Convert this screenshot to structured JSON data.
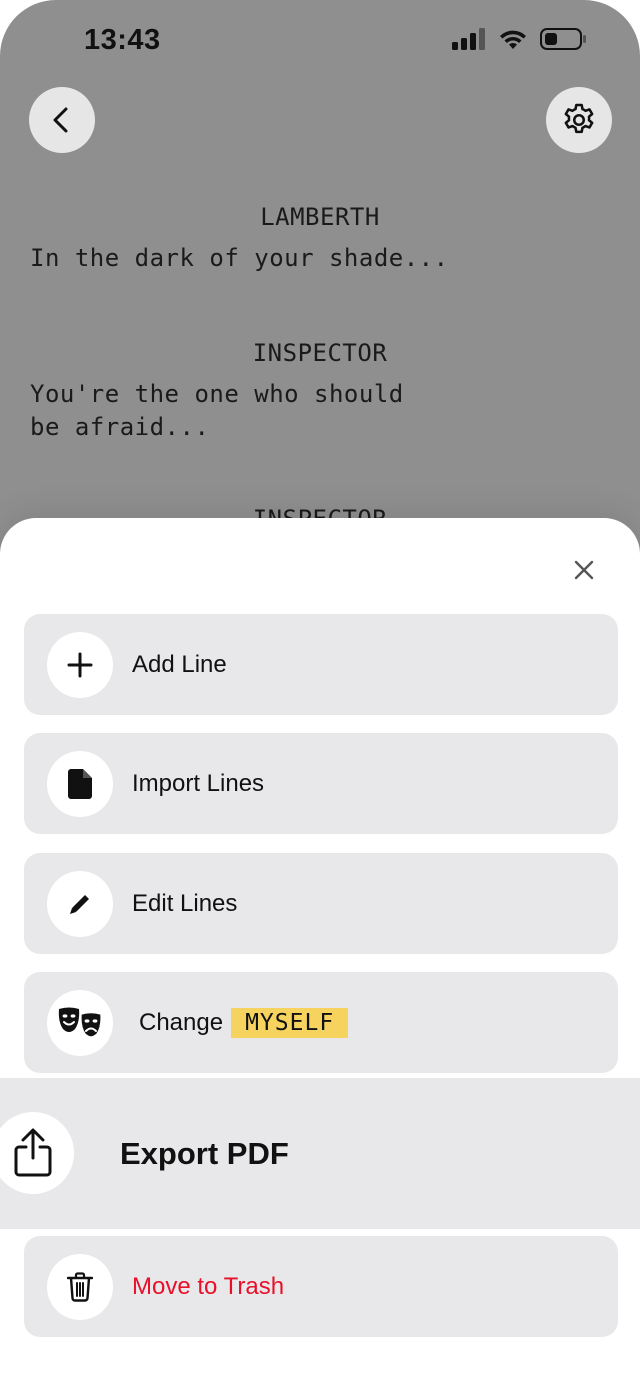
{
  "status_bar": {
    "time": "13:43"
  },
  "script": {
    "blocks": [
      {
        "character": "LAMBERTH",
        "dialogue": "In the dark of your shade..."
      },
      {
        "character": "INSPECTOR",
        "dialogue": "You're the one who should\nbe afraid..."
      },
      {
        "character": "INSPECTOR"
      }
    ]
  },
  "menu": {
    "add_line": "Add Line",
    "import_lines": "Import Lines",
    "edit_lines": "Edit Lines",
    "change_label": "Change",
    "change_badge": "MYSELF",
    "export_pdf": "Export PDF",
    "move_to_trash": "Move to Trash"
  },
  "colors": {
    "accent_yellow": "#f6d35f",
    "danger_red": "#e8112b",
    "card_gray": "#e8e8ea",
    "backdrop_gray": "#8f8f8f"
  },
  "icons": [
    "back-icon",
    "gear-icon",
    "close-icon",
    "plus-icon",
    "document-icon",
    "pencil-icon",
    "theater-masks-icon",
    "share-icon",
    "trash-icon",
    "cellular-signal-icon",
    "wifi-icon",
    "battery-icon"
  ]
}
